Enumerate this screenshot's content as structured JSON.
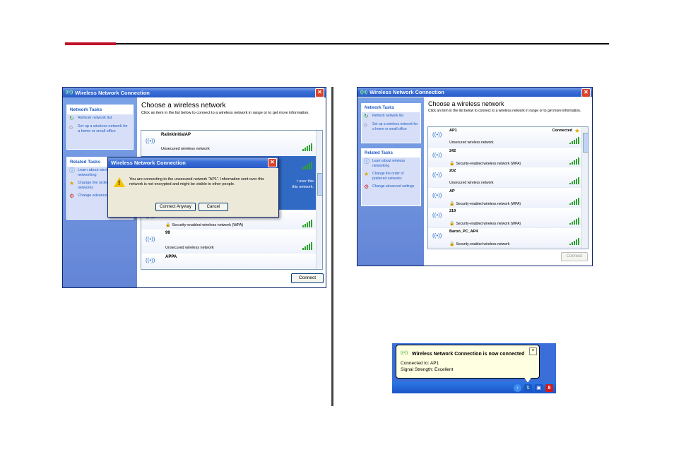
{
  "window_left": {
    "title": "Wireless Network Connection",
    "network_tasks": {
      "header": "Network Tasks",
      "items": [
        {
          "label": "Refresh network list",
          "icon": "refresh-icon"
        },
        {
          "label": "Set up a wireless network for a home or small office",
          "icon": "setup-icon"
        }
      ]
    },
    "related_tasks": {
      "header": "Related Tasks",
      "items": [
        {
          "label": "Learn about wireless networking",
          "icon": "learn-icon"
        },
        {
          "label": "Change the order of preferred networks",
          "icon": "star-icon"
        },
        {
          "label": "Change advanced settings",
          "icon": "settings-icon"
        }
      ]
    },
    "heading": "Choose a wireless network",
    "intro": "Click an item in the list below to connect to a wireless network in range or to get more information.",
    "networks": [
      {
        "ssid": "RalinkInitialAP",
        "status": "Unsecured wireless network"
      },
      {
        "ssid": "",
        "status": "Security-enabled wireless network (WPA)"
      },
      {
        "ssid": "99",
        "status": "Unsecured wireless network"
      },
      {
        "ssid": "APPA",
        "status": ""
      }
    ],
    "connect_label": "Connect",
    "dialog": {
      "title": "Wireless Network Connection",
      "message": "You are connecting to the unsecured network \"AP1\". Information sent over this network is not encrypted and might be visible to other people.",
      "connect_anyway": "Connect Anyway",
      "cancel": "Cancel",
      "behind_text_1": "t over this",
      "behind_text_2": "this network."
    }
  },
  "window_right": {
    "title": "Wireless Network Connection",
    "network_tasks": {
      "header": "Network Tasks",
      "items": [
        {
          "label": "Refresh network list",
          "icon": "refresh-icon"
        },
        {
          "label": "Set up a wireless network for a home or small office",
          "icon": "setup-icon"
        }
      ]
    },
    "related_tasks": {
      "header": "Related Tasks",
      "items": [
        {
          "label": "Learn about wireless networking",
          "icon": "learn-icon"
        },
        {
          "label": "Change the order of preferred networks",
          "icon": "star-icon"
        },
        {
          "label": "Change advanced settings",
          "icon": "settings-icon"
        }
      ]
    },
    "heading": "Choose a wireless network",
    "intro": "Click an item in the list below to connect to a wireless network in range or to get more information.",
    "networks": [
      {
        "ssid": "AP1",
        "status": "Unsecured wireless network",
        "connected": "Connected",
        "secured": false
      },
      {
        "ssid": "242",
        "status": "Security-enabled wireless network (WPA)",
        "secured": true
      },
      {
        "ssid": "202",
        "status": "Unsecured wireless network",
        "secured": false
      },
      {
        "ssid": "AP",
        "status": "Security-enabled wireless network (WPA)",
        "secured": true
      },
      {
        "ssid": "219",
        "status": "Security-enabled wireless network (WPA)",
        "secured": true
      },
      {
        "ssid": "Baron_PC_AP4",
        "status": "Security-enabled wireless network",
        "secured": true
      }
    ],
    "connect_label": "Connect"
  },
  "balloon": {
    "title": "Wireless Network Connection is now connected",
    "connected_to": "Connected to: AP1",
    "signal_strength": "Signal Strength: Excellent"
  },
  "colors": {
    "accent_red": "#c0102a",
    "xp_blue": "#3a6ed8",
    "signal_green": "#2fa32f"
  }
}
